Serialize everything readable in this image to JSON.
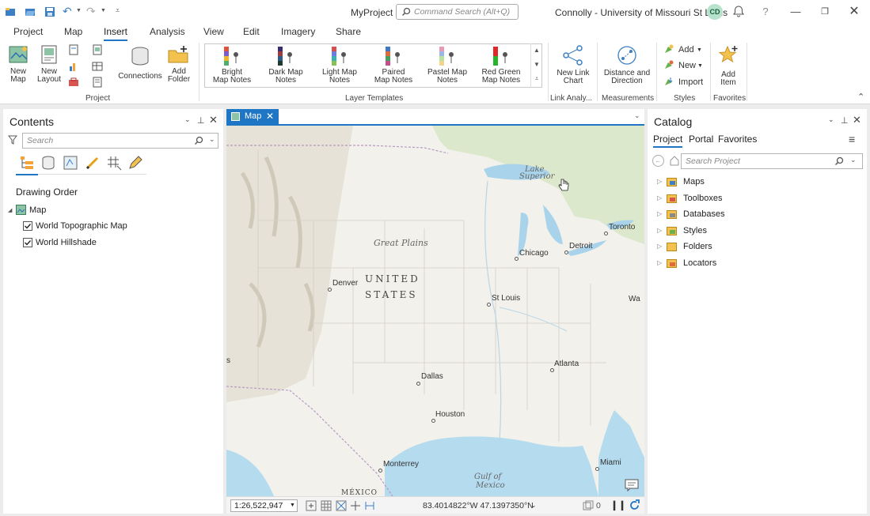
{
  "app": {
    "project_title": "MyProject",
    "command_search_placeholder": "Command Search (Alt+Q)",
    "user": "Connolly - University of Missouri St Louis",
    "user_initials": "CD",
    "help": "?"
  },
  "ribbon_tabs": [
    "Project",
    "Map",
    "Insert",
    "Analysis",
    "View",
    "Edit",
    "Imagery",
    "Share"
  ],
  "active_tab": "Insert",
  "ribbon": {
    "new_map": "New\nMap",
    "new_layout": "New\nLayout",
    "connections": "Connections",
    "add_folder": "Add\nFolder",
    "project_group": "Project",
    "layer_templates": [
      {
        "label": "Bright\nMap Notes",
        "colors": [
          "#e0523c",
          "#7a5bd6",
          "#f2b52a",
          "#4caf6c"
        ]
      },
      {
        "label": "Dark Map\nNotes",
        "colors": [
          "#3b2d74",
          "#a13a3a",
          "#2c5c8c",
          "#1f3a2f"
        ]
      },
      {
        "label": "Light Map\nNotes",
        "colors": [
          "#d94e4e",
          "#6c7fe0",
          "#3bb2b2",
          "#88c057"
        ]
      },
      {
        "label": "Paired\nMap Notes",
        "colors": [
          "#3e78c4",
          "#e06b3d",
          "#44a05a",
          "#c24e8c"
        ]
      },
      {
        "label": "Pastel Map\nNotes",
        "colors": [
          "#e89ab8",
          "#9bb7e8",
          "#b6e29a",
          "#f2d48a"
        ]
      },
      {
        "label": "Red Green\nMap Notes",
        "colors": [
          "#e02828",
          "#e02828",
          "#28b428",
          "#28b428"
        ]
      }
    ],
    "layer_templates_group": "Layer Templates",
    "new_link_chart": "New Link\nChart",
    "link_analysis_group": "Link Analy...",
    "distance_direction": "Distance and\nDirection",
    "measurements_group": "Measurements",
    "styles_add": "Add",
    "styles_new": "New",
    "styles_import": "Import",
    "styles_group": "Styles",
    "add_item": "Add\nItem",
    "favorites_group": "Favorites"
  },
  "contents": {
    "title": "Contents",
    "search_placeholder": "Search",
    "section": "Drawing Order",
    "map_name": "Map",
    "layers": [
      {
        "name": "World Topographic Map",
        "checked": true
      },
      {
        "name": "World Hillshade",
        "checked": true
      }
    ]
  },
  "map_view": {
    "tab_label": "Map",
    "scale": "1:26,522,947",
    "coordinates": "83.4014822°W 47.1397350°N",
    "selected_count": "0",
    "labels": {
      "country_1": "UNITED",
      "country_2": "STATES",
      "great_plains": "Great Plains",
      "lake_superior_1": "Lake",
      "lake_superior_2": "Superior",
      "gulf_1": "Gulf of",
      "gulf_2": "Mexico",
      "mexico": "MÉXICO",
      "partial_s": "s",
      "partial_wa": "Wa"
    },
    "cities": [
      "Denver",
      "Chicago",
      "Detroit",
      "Toronto",
      "St Louis",
      "Atlanta",
      "Dallas",
      "Houston",
      "Monterrey",
      "Miami"
    ]
  },
  "catalog": {
    "title": "Catalog",
    "tabs": [
      "Project",
      "Portal",
      "Favorites"
    ],
    "active_tab": "Project",
    "search_placeholder": "Search Project",
    "items": [
      "Maps",
      "Toolboxes",
      "Databases",
      "Styles",
      "Folders",
      "Locators"
    ]
  }
}
